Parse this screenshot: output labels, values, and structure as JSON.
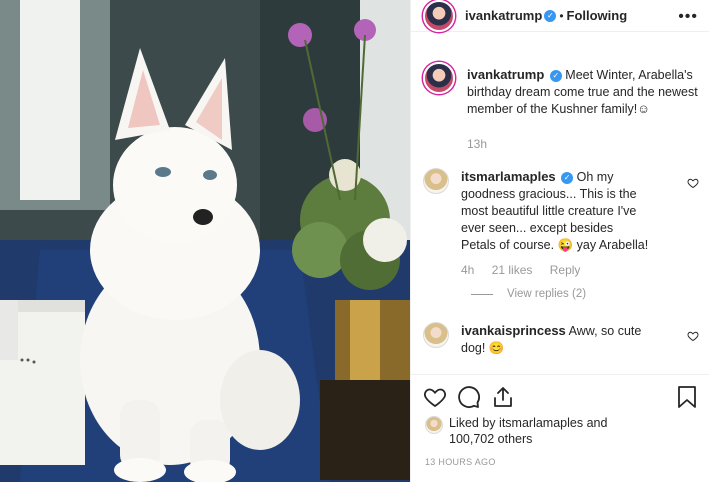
{
  "post": {
    "username": "ivankatrump",
    "follow_label": "Following",
    "caption": "Meet Winter, Arabella's birthday dream come true and the newest member of the Kushner family!",
    "caption_emoji": "☺",
    "caption_time": "13h"
  },
  "comments": [
    {
      "username": "itsmarlamaples",
      "text": "Oh my goodness gracious... This is the most beautiful little creature I've ever seen... except besides Petals of course. 😜 yay Arabella!",
      "time": "4h",
      "likes": "21 likes",
      "reply_label": "Reply",
      "view_replies": "View replies (2)"
    },
    {
      "username": "ivankaisprincess",
      "text": "Aww, so cute dog! 😊"
    }
  ],
  "footer": {
    "liked_by_prefix": "Liked by",
    "liked_by_user": "itsmarlamaples",
    "liked_by_suffix": "and",
    "liked_by_count": "100,702 others",
    "timestamp": "13 HOURS AGO"
  },
  "colors": {
    "verified": "#3897f0",
    "muted_text": "#999999",
    "text": "#262626"
  }
}
